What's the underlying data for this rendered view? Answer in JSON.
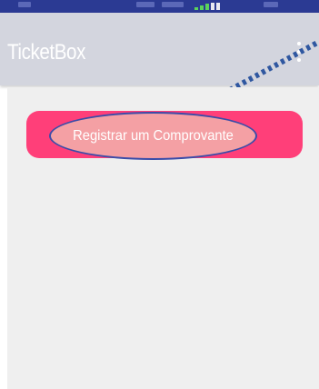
{
  "app_bar": {
    "title": "TicketBox",
    "menu_icon": "more-vert-icon"
  },
  "main": {
    "register_button_label": "Registrar um Comprovante"
  },
  "colors": {
    "status_bar": "#2b3a93",
    "app_bar": "#d3d5de",
    "button": "#ff3f79",
    "highlight": "#f4a0a4",
    "highlight_outline": "#3b4ca8",
    "pointer_line": "#2f57a0",
    "content_background": "#efefef"
  }
}
